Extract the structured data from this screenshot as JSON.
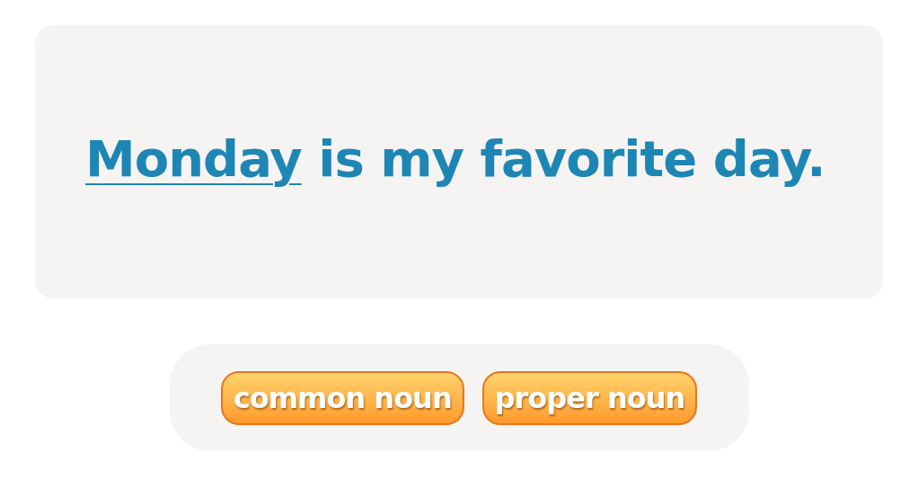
{
  "sentence": {
    "underlined": "Monday",
    "rest": "is my favorite day."
  },
  "choices": [
    {
      "label": "common noun"
    },
    {
      "label": "proper noun"
    }
  ]
}
